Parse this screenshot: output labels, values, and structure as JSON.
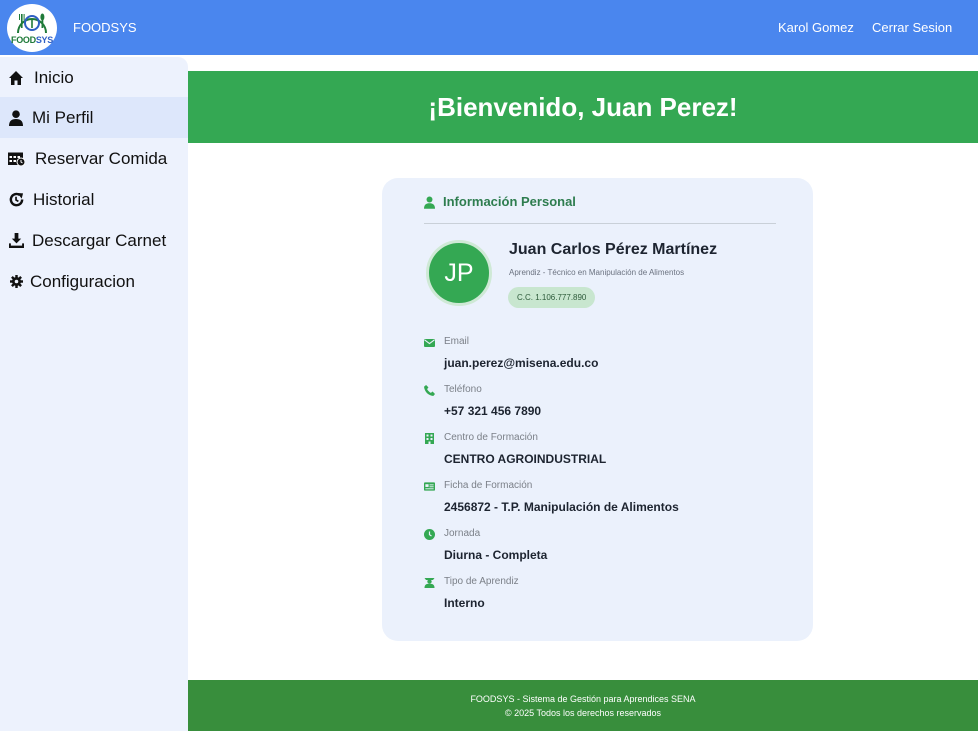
{
  "header": {
    "logo_text_a": "FOOD",
    "logo_text_b": "SYS",
    "brand": "FOODSYS",
    "user_name": "Karol Gomez",
    "logout_label": "Cerrar Sesion"
  },
  "sidebar": {
    "items": [
      {
        "label": "Inicio",
        "icon": "home-icon"
      },
      {
        "label": "Mi Perfil",
        "icon": "user-icon"
      },
      {
        "label": "Reservar Comida",
        "icon": "calendar-icon"
      },
      {
        "label": "Historial",
        "icon": "history-icon"
      },
      {
        "label": "Descargar Carnet",
        "icon": "download-icon"
      },
      {
        "label": "Configuracion",
        "icon": "gear-icon"
      }
    ],
    "active_index": 1
  },
  "hero": {
    "title": "¡Bienvenido, Juan Perez!"
  },
  "profile": {
    "section_title": "Información Personal",
    "initials": "JP",
    "full_name": "Juan Carlos Pérez Martínez",
    "role": "Aprendiz - Técnico en Manipulación de Alimentos",
    "id_badge": "C.C. 1.106.777.890",
    "fields": [
      {
        "label": "Email",
        "value": "juan.perez@misena.edu.co",
        "icon": "envelope-icon"
      },
      {
        "label": "Teléfono",
        "value": "+57 321 456 7890",
        "icon": "phone-icon"
      },
      {
        "label": "Centro de Formación",
        "value": "CENTRO AGROINDUSTRIAL",
        "icon": "building-icon"
      },
      {
        "label": "Ficha de Formación",
        "value": "2456872 - T.P. Manipulación de Alimentos",
        "icon": "id-card-icon"
      },
      {
        "label": "Jornada",
        "value": "Diurna - Completa",
        "icon": "clock-icon"
      },
      {
        "label": "Tipo de Aprendiz",
        "value": "Interno",
        "icon": "graduate-icon"
      }
    ]
  },
  "footer": {
    "line1": "FOODSYS - Sistema de Gestión para Aprendices SENA",
    "line2": "© 2025 Todos los derechos reservados"
  },
  "colors": {
    "header_bg": "#4a86ee",
    "sidebar_bg": "#edf2fd",
    "accent_green": "#34a853",
    "footer_bg": "#388e3c",
    "card_bg": "#ebf1fc"
  }
}
